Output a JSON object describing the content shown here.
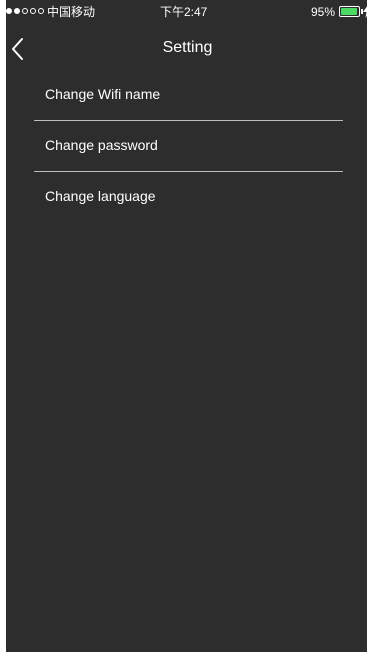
{
  "status_bar": {
    "carrier": "中国移动",
    "time": "下午2:47",
    "battery_percent": "95%",
    "battery_level": 0.95,
    "signal_dots_filled": 2,
    "signal_dots_total": 5,
    "battery_color": "#4cd964"
  },
  "nav": {
    "title": "Setting",
    "back_icon": "chevron-left-icon"
  },
  "menu": {
    "items": [
      {
        "label": "Change Wifi name"
      },
      {
        "label": "Change password"
      },
      {
        "label": "Change language"
      }
    ]
  },
  "colors": {
    "background": "#2d2d2d",
    "text": "#ffffff",
    "divider": "#bdbdbd"
  }
}
